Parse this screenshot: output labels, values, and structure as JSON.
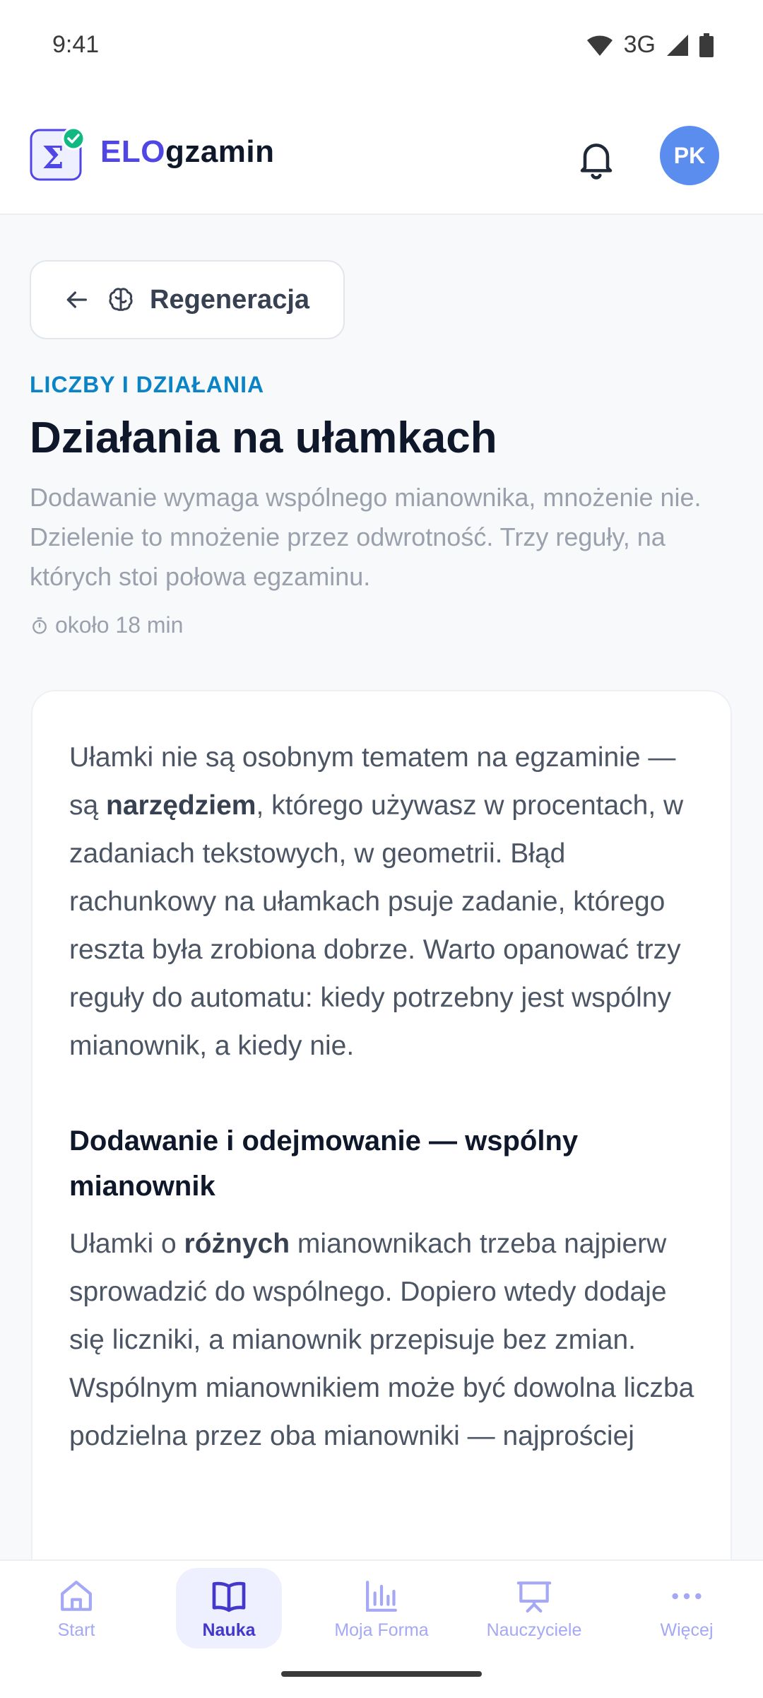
{
  "status": {
    "time": "9:41",
    "network": "3G"
  },
  "app": {
    "brand_part1": "ELO",
    "brand_part2": "gzamin",
    "avatar_initials": "PK"
  },
  "back_chip": {
    "label": "Regeneracja"
  },
  "lesson": {
    "category": "LICZBY I DZIAŁANIA",
    "title": "Działania na ułamkach",
    "lead": "Dodawanie wymaga wspólnego mianownika, mnożenie nie. Dzielenie to mnożenie przez odwrotność. Trzy reguły, na których stoi połowa egzaminu.",
    "duration": "około 18 min",
    "p1": {
      "before": "Ułamki nie są osobnym tematem na egzaminie — są ",
      "bold": "narzędziem",
      "after": ", którego używasz w procentach, w zadaniach tekstowych, w geometrii. Błąd rachunkowy na ułamkach psuje zadanie, którego reszta była zrobiona dobrze. Warto opanować trzy reguły do automatu: kiedy potrzebny jest wspólny mianownik, a kiedy nie."
    },
    "section1_title": "Dodawanie i odejmowanie — wspólny mianownik",
    "p2": {
      "before": "Ułamki o ",
      "bold": "różnych",
      "after": " mianownikach trzeba najpierw sprowadzić do wspólnego. Dopiero wtedy dodaje się liczniki, a mianownik przepisuje bez zmian. Wspólnym mianownikiem może być dowolna liczba podzielna przez oba mianowniki — najprościej"
    }
  },
  "nav": {
    "items": [
      {
        "label": "Start"
      },
      {
        "label": "Nauka"
      },
      {
        "label": "Moja Forma"
      },
      {
        "label": "Nauczyciele"
      },
      {
        "label": "Więcej"
      }
    ],
    "active": "Nauka"
  },
  "colors": {
    "accent": "#4f46e5",
    "category": "#0b84c6",
    "avatar": "#5b8def",
    "nav_inactive": "#a5a8f5"
  }
}
